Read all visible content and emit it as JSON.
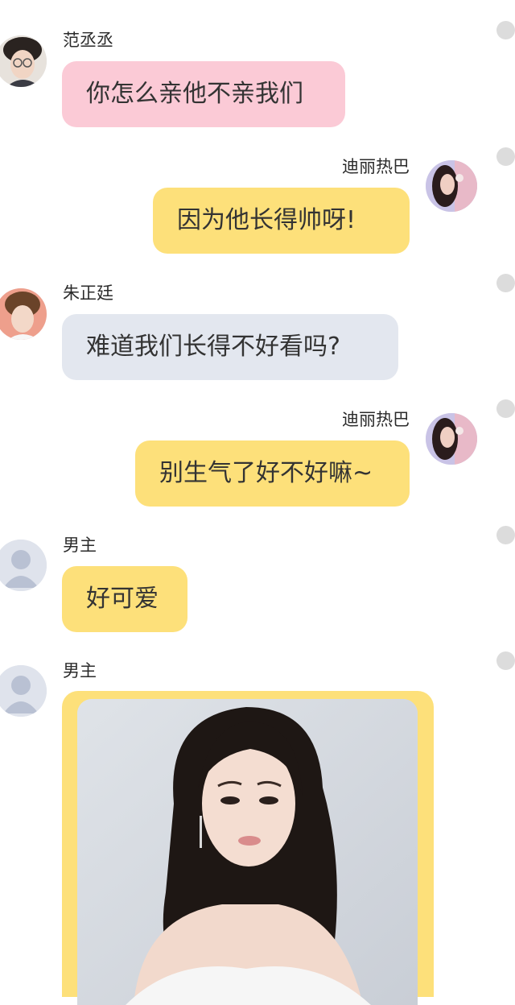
{
  "messages": [
    {
      "sender": "范丞丞",
      "text": "你怎么亲他不亲我们"
    },
    {
      "sender": "迪丽热巴",
      "text": "因为他长得帅呀!"
    },
    {
      "sender": "朱正廷",
      "text": "难道我们长得不好看吗?"
    },
    {
      "sender": "迪丽热巴",
      "text": "别生气了好不好嘛~"
    },
    {
      "sender": "男主",
      "text": "好可爱"
    },
    {
      "sender": "男主",
      "image": "photo-of-woman-pouting"
    }
  ],
  "colors": {
    "pink_bubble": "#fbcad6",
    "yellow_bubble": "#fde07a",
    "gray_bubble": "#e3e7ef",
    "selector": "#dcdcdc"
  }
}
